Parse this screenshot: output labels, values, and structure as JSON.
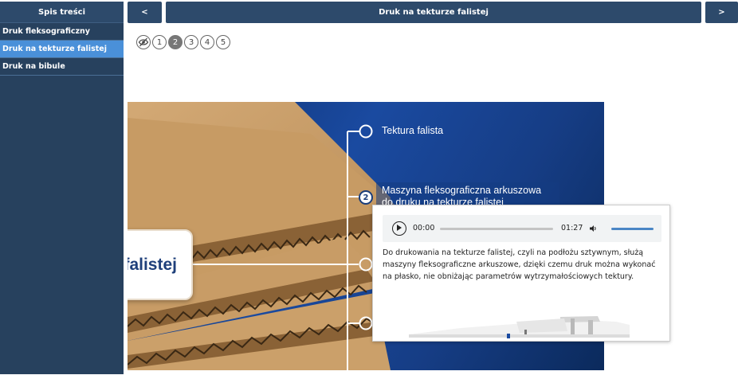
{
  "sidebar": {
    "title": "Spis treści",
    "items": [
      {
        "label": "Druk fleksograficzny",
        "active": false
      },
      {
        "label": "Druk na tekturze falistej",
        "active": true
      },
      {
        "label": "Druk na bibule",
        "active": false
      }
    ]
  },
  "header": {
    "prev_label": "<",
    "title": "Druk na tekturze falistej",
    "next_label": ">"
  },
  "pager": {
    "pages": [
      "1",
      "2",
      "3",
      "4",
      "5"
    ],
    "current": "2"
  },
  "diagram": {
    "nodes": [
      {
        "label": "Tektura falista"
      },
      {
        "number": "2",
        "label_line1": "Maszyna fleksograficzna arkuszowa",
        "label_line2": "do druku na tekturze falistej"
      }
    ],
    "center_card_text": "falistej"
  },
  "popup": {
    "audio": {
      "current_time": "00:00",
      "duration": "01:27",
      "progress": 0
    },
    "text": "Do drukowania na tekturze falistej, czyli na podłożu sztywnym, służą maszyny fleksograficzne arkuszowe, dzięki czemu druk można wykonać na płasko, nie obniżając parametrów wytrzymałościowych tektury."
  },
  "colors": {
    "sidebar_bg": "#27415e",
    "active_item": "#4a90d9",
    "stage_bg": "#1a4aa0",
    "cardboard": "#c69b66"
  }
}
